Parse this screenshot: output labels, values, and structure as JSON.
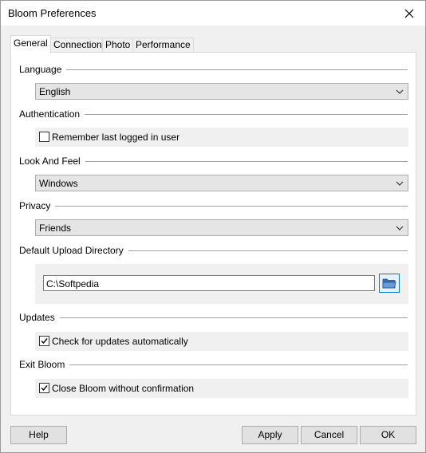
{
  "window": {
    "title": "Bloom Preferences"
  },
  "tabs": [
    {
      "label": "General"
    },
    {
      "label": "Connection"
    },
    {
      "label": "Photo"
    },
    {
      "label": "Performance"
    }
  ],
  "general": {
    "language": {
      "label": "Language",
      "value": "English"
    },
    "authentication": {
      "label": "Authentication",
      "option": "Remember last logged in user",
      "checked": false
    },
    "look_and_feel": {
      "label": "Look And Feel",
      "value": "Windows"
    },
    "privacy": {
      "label": "Privacy",
      "value": "Friends"
    },
    "upload_dir": {
      "label": "Default Upload Directory",
      "value": "C:\\Softpedia"
    },
    "updates": {
      "label": "Updates",
      "option": "Check for updates automatically",
      "checked": true
    },
    "exit": {
      "label": "Exit Bloom",
      "option": "Close Bloom without confirmation",
      "checked": true
    }
  },
  "buttons": {
    "help": "Help",
    "apply": "Apply",
    "cancel": "Cancel",
    "ok": "OK"
  },
  "icons": {
    "close": "close-icon",
    "dropdown": "chevron-down-icon",
    "check": "checkmark-icon",
    "folder": "folder-icon"
  }
}
